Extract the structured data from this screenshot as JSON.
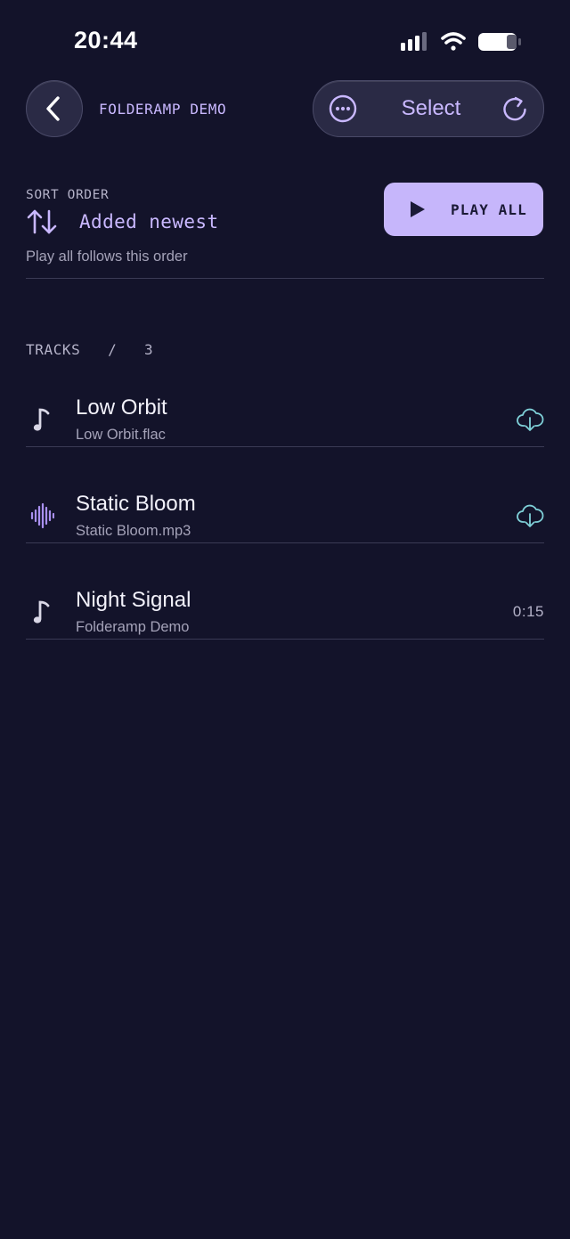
{
  "status_bar": {
    "time": "20:44",
    "icons": [
      "cellular-signal-icon",
      "wifi-icon",
      "battery-icon"
    ]
  },
  "header": {
    "back_icon": "chevron-left-icon",
    "title": "FOLDERAMP DEMO",
    "more_icon": "ellipsis-circle-icon",
    "select_label": "Select",
    "refresh_icon": "refresh-icon"
  },
  "sort": {
    "heading": "SORT ORDER",
    "value": "Added newest",
    "icon": "sort-arrows-icon",
    "hint": "Play all follows this order",
    "play_all_label": "PLAY ALL",
    "play_icon": "play-icon"
  },
  "tracks": {
    "heading": "TRACKS   /   3",
    "items": [
      {
        "title": "Low Orbit",
        "subtitle": "Low Orbit.flac",
        "icon": "music-note-icon",
        "trailing_icon": "cloud-download-icon",
        "trailing_text": ""
      },
      {
        "title": "Static Bloom",
        "subtitle": "Static Bloom.mp3",
        "icon": "waveform-icon",
        "trailing_icon": "cloud-download-icon",
        "trailing_text": ""
      },
      {
        "title": "Night Signal",
        "subtitle": "Folderamp Demo",
        "icon": "music-note-icon",
        "trailing_icon": "",
        "trailing_text": "0:15"
      }
    ]
  },
  "colors": {
    "background": "#13132a",
    "accent": "#c9b8ff",
    "play_button": "#c6b6fb",
    "cloud": "#7fd0d8",
    "divider": "#3a3a55"
  }
}
